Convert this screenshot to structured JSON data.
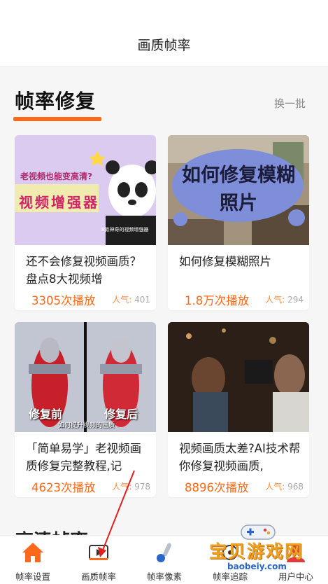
{
  "header": {
    "title": "画质帧率"
  },
  "section": {
    "title": "帧率修复",
    "refresh_label": "换一批"
  },
  "cards": [
    {
      "thumb_caption": "老视频也能变高清?",
      "thumb_banner": "视频增强器",
      "thumb_badge": "8款神奇的视频增强器",
      "title": "还不会修复视频画质？盘点8大视频增",
      "plays": "3305次播放",
      "popularity_label": "人气:",
      "popularity": "401"
    },
    {
      "thumb_caption": "如何修复模糊照片",
      "title": "如何修复模糊照片",
      "plays": "1.8万次播放",
      "popularity_label": "人气:",
      "popularity": "294"
    },
    {
      "thumb_left": "修复前",
      "thumb_right": "修复后",
      "thumb_sub": "如何提升视频的画质",
      "title": "「简单易学」老视频画质修复完整教程,记",
      "plays": "4623次播放",
      "popularity_label": "人气:",
      "popularity": "978"
    },
    {
      "title": "视频画质太差?AI技术帮你修复视频画质,",
      "plays": "8896次播放",
      "popularity_label": "人气:",
      "popularity": "968"
    }
  ],
  "next_section_peek": "高清帧率",
  "tabs": [
    {
      "label": "帧率设置",
      "icon": "home-icon",
      "active": true
    },
    {
      "label": "画质帧率",
      "icon": "video-frame-icon",
      "active": false
    },
    {
      "label": "帧率像素",
      "icon": "brush-icon",
      "active": false
    },
    {
      "label": "帧率追踪",
      "icon": "tracking-icon",
      "active": false
    },
    {
      "label": "用户中心",
      "icon": "user-icon",
      "active": false
    }
  ],
  "watermark": {
    "text": "宝贝游戏网",
    "url": "baobeiy.com"
  },
  "colors": {
    "accent": "#ff6a1a",
    "annotation": "#e02020"
  }
}
